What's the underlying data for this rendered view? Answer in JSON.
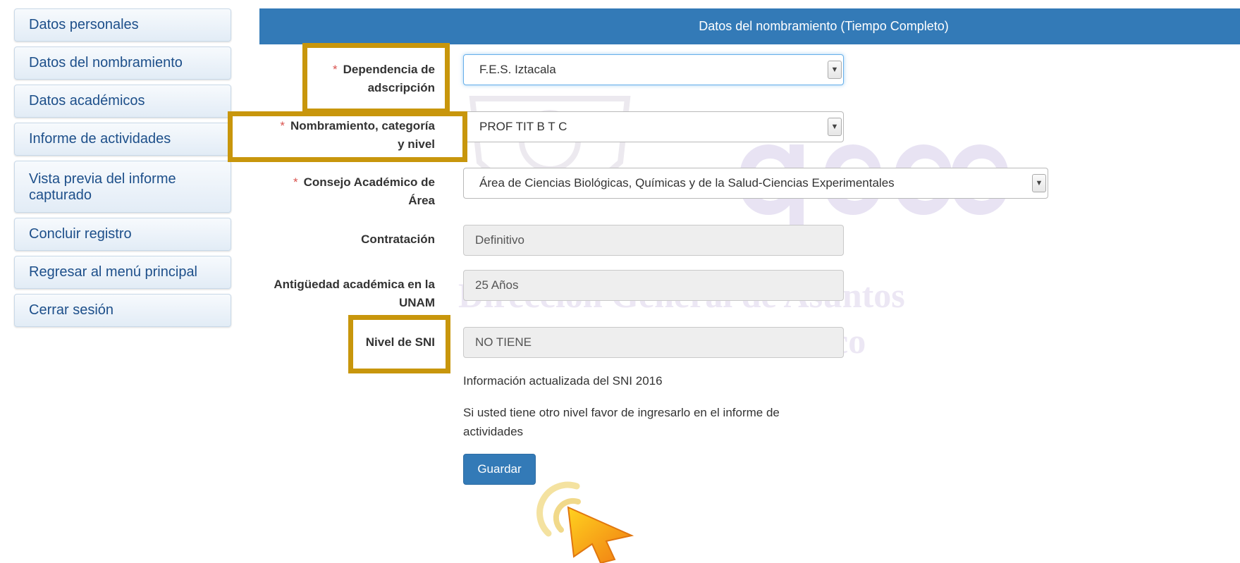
{
  "sidebar": {
    "items": [
      {
        "label": "Datos personales"
      },
      {
        "label": "Datos del nombramiento"
      },
      {
        "label": "Datos académicos"
      },
      {
        "label": "Informe de actividades"
      },
      {
        "label": "Vista previa del informe capturado"
      },
      {
        "label": "Concluir registro"
      },
      {
        "label": "Regresar al menú principal"
      },
      {
        "label": "Cerrar sesión"
      }
    ]
  },
  "header": {
    "title": "Datos del nombramiento (Tiempo Completo)"
  },
  "watermark": {
    "line1": "Dirección General de Asuntos",
    "line2": "del Personal Académico",
    "logo": "dgapa"
  },
  "form": {
    "required_mark": "*",
    "dependencia": {
      "label": "Dependencia de adscripción",
      "value": "F.E.S. Iztacala"
    },
    "nombramiento": {
      "label": "Nombramiento, categoría y nivel",
      "value": "PROF TIT B T C"
    },
    "consejo": {
      "label": "Consejo Académico de Área",
      "value": "Área de Ciencias Biológicas, Químicas y de la Salud-Ciencias Experimentales"
    },
    "contratacion": {
      "label": "Contratación",
      "value": "Definitivo"
    },
    "antiguedad": {
      "label": "Antigüedad académica en la UNAM",
      "value": "25 Años"
    },
    "sni": {
      "label": "Nivel de SNI",
      "value": "NO TIENE"
    },
    "info_sni": "Información actualizada del SNI 2016",
    "info_otro": "Si usted tiene otro nivel favor de ingresarlo en el informe de actividades",
    "save_label": "Guardar"
  },
  "colors": {
    "header": "#337ab7",
    "highlight": "#c8960c",
    "required": "#d9534f"
  },
  "icons": {
    "select_arrow": "chevron-down-icon",
    "cursor": "click-cursor-icon"
  }
}
